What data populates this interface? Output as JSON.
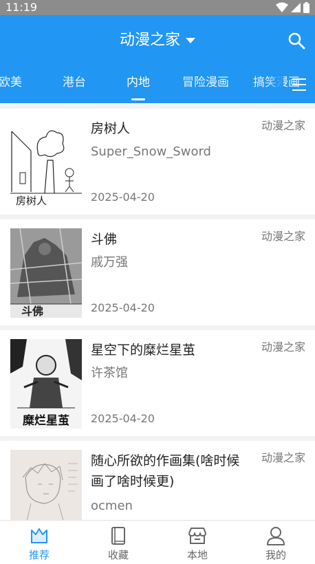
{
  "status": {
    "time": "11:19"
  },
  "header": {
    "title": "动漫之家"
  },
  "tabs": [
    {
      "label": "欧美"
    },
    {
      "label": "港台"
    },
    {
      "label": "内地"
    },
    {
      "label": "冒险漫画"
    },
    {
      "label": "搞笑漫画"
    }
  ],
  "items": [
    {
      "title": "房树人",
      "author": "Super_Snow_Sword",
      "date": "2025-04-20",
      "source": "动漫之家"
    },
    {
      "title": "斗佛",
      "author": "戚万强",
      "date": "2025-04-20",
      "source": "动漫之家"
    },
    {
      "title": "星空下的糜烂星茧",
      "author": "许茶馆",
      "date": "2025-04-20",
      "source": "动漫之家"
    },
    {
      "title": "随心所欲的作画集(啥时候画了啥时候更)",
      "author": "ocmen",
      "date": "",
      "source": "动漫之家"
    }
  ],
  "covers": {
    "item0": "房树人",
    "item1": "斗佛",
    "item2": "糜烂星茧"
  },
  "nav": [
    {
      "label": "推荐"
    },
    {
      "label": "收藏"
    },
    {
      "label": "本地"
    },
    {
      "label": "我的"
    }
  ],
  "colors": {
    "primary": "#2196f3",
    "statusbar": "#8c8c8c"
  }
}
